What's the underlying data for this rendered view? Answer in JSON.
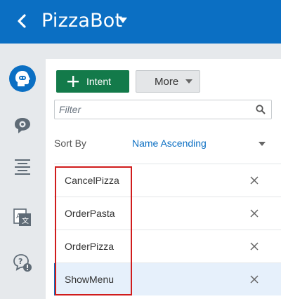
{
  "header": {
    "title": "PizzaBot",
    "back_icon": "chevron-left-icon",
    "menu_icon": "caret-down-icon",
    "bg_color": "#0b6fc3"
  },
  "rail": {
    "items": [
      {
        "icon": "bot-head-icon",
        "active": true
      },
      {
        "icon": "chat-bubble-gear-icon",
        "active": false
      },
      {
        "icon": "text-lines-icon",
        "active": false
      },
      {
        "icon": "translate-icon",
        "active": false
      },
      {
        "icon": "question-bubble-icon",
        "active": false
      }
    ]
  },
  "toolbar": {
    "intent_label": "Intent",
    "more_label": "More",
    "intent_color": "#137a4a"
  },
  "filter": {
    "placeholder": "Filter",
    "value": ""
  },
  "sort": {
    "label": "Sort By",
    "value": "Name Ascending"
  },
  "intents": [
    {
      "name": "CancelPizza",
      "selected": false
    },
    {
      "name": "OrderPasta",
      "selected": false
    },
    {
      "name": "OrderPizza",
      "selected": false
    },
    {
      "name": "ShowMenu",
      "selected": true
    }
  ]
}
